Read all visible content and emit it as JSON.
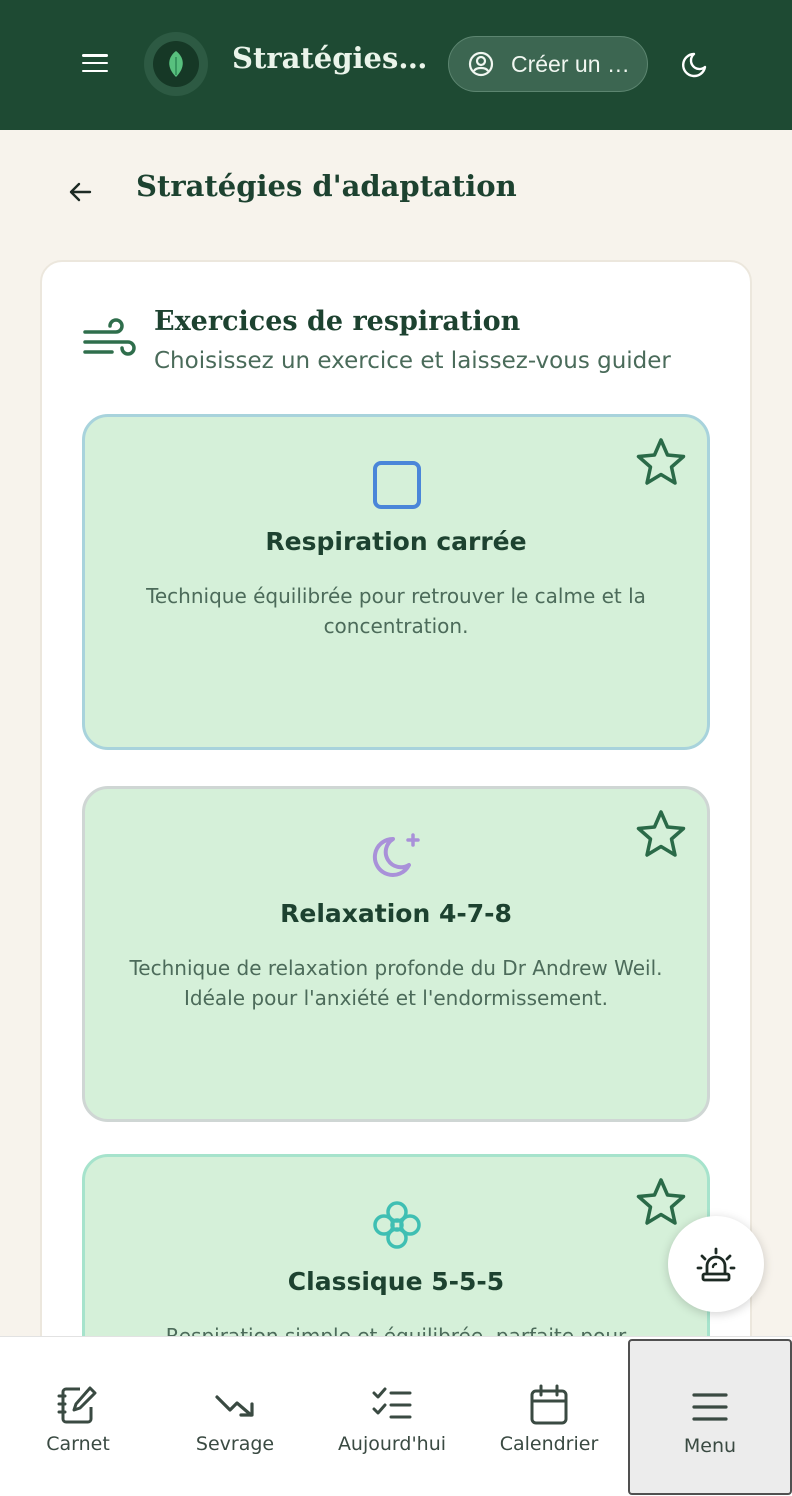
{
  "header": {
    "title": "Stratégies d'adaptation",
    "create_account_label": "Créer un compte"
  },
  "page": {
    "title": "Stratégies d'adaptation"
  },
  "section": {
    "title": "Exercices de respiration",
    "subtitle": "Choisissez un exercice et laissez-vous guider"
  },
  "exercises": [
    {
      "name": "Respiration carrée",
      "description": "Technique équilibrée pour retrouver le calme et la concentration.",
      "icon": "square-icon",
      "color": "#4a86d9",
      "border_color": "#a8d3dc"
    },
    {
      "name": "Relaxation 4-7-8",
      "description": "Technique de relaxation profonde du Dr Andrew Weil. Idéale pour l'anxiété et l'endormissement.",
      "icon": "moon-star-icon",
      "color": "#a991d9",
      "border_color": "#cfd6d4"
    },
    {
      "name": "Classique 5-5-5",
      "description": "Respiration simple et équilibrée, parfaite pour débuter.",
      "icon": "flower-icon",
      "color": "#3fbfb3",
      "border_color": "#a6e3cc"
    }
  ],
  "bottom_nav": [
    {
      "label": "Carnet",
      "icon": "notebook-pen-icon"
    },
    {
      "label": "Sevrage",
      "icon": "trending-down-icon"
    },
    {
      "label": "Aujourd'hui",
      "icon": "list-checks-icon"
    },
    {
      "label": "Calendrier",
      "icon": "calendar-icon"
    },
    {
      "label": "Menu",
      "icon": "menu-icon",
      "active": true
    }
  ],
  "colors": {
    "header_bg": "#1e4a33",
    "accent": "#2f6e4c",
    "card_bg": "#d5f0d9"
  }
}
